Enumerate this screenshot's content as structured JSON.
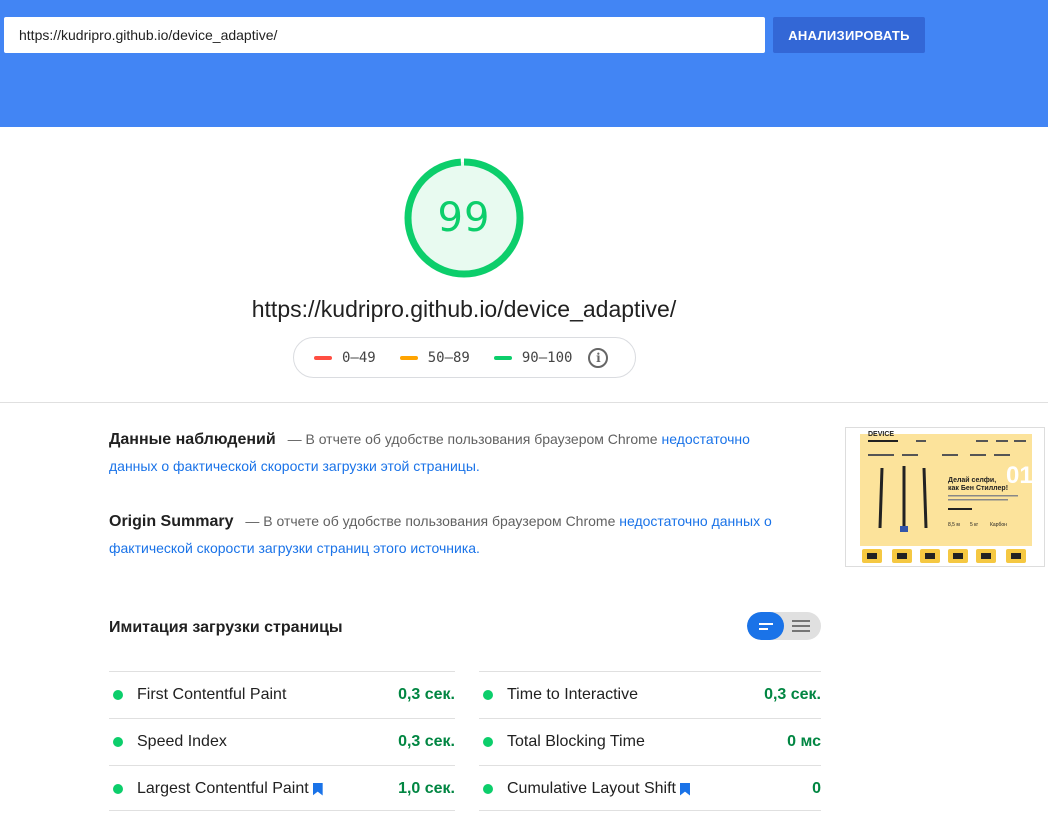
{
  "search": {
    "url_value": "https://kudripro.github.io/device_adaptive/",
    "analyze_label": "АНАЛИЗИРОВАТЬ"
  },
  "report": {
    "score": "99",
    "score_fraction": 0.99,
    "page_url": "https://kudripro.github.io/device_adaptive/"
  },
  "legend": {
    "items": [
      {
        "label": "0–49",
        "color": "#ff4e42"
      },
      {
        "label": "50–89",
        "color": "#ffa400"
      },
      {
        "label": "90–100",
        "color": "#0cce6b"
      }
    ],
    "info_icon": "info-icon"
  },
  "field_data": {
    "title": "Данные наблюдений",
    "dash": "—",
    "text": "В отчете об удобстве пользования браузером Chrome",
    "link": "недостаточно данных о фактической скорости загрузки этой страницы."
  },
  "origin_summary": {
    "title": "Origin Summary",
    "dash": "—",
    "text": "В отчете об удобстве пользования браузером Chrome",
    "link": "недостаточно данных о фактической скорости загрузки страниц этого источника."
  },
  "thumbnail": {
    "brand": "DEVICE",
    "headline_1": "Делай селфи,",
    "headline_2": "как Бен Стиллер!",
    "slide_number": "01",
    "stat_1": "8,5 м",
    "stat_2": "5 кг",
    "stat_3": "Карбон"
  },
  "lab": {
    "title": "Имитация загрузки страницы",
    "metrics": [
      {
        "name": "First Contentful Paint",
        "value": "0,3 сек.",
        "bookmark": false
      },
      {
        "name": "Time to Interactive",
        "value": "0,3 сек.",
        "bookmark": false
      },
      {
        "name": "Speed Index",
        "value": "0,3 сек.",
        "bookmark": false
      },
      {
        "name": "Total Blocking Time",
        "value": "0 мс",
        "bookmark": false
      },
      {
        "name": "Largest Contentful Paint",
        "value": "1,0 сек.",
        "bookmark": true
      },
      {
        "name": "Cumulative Layout Shift",
        "value": "0",
        "bookmark": true
      }
    ]
  },
  "colors": {
    "brand_blue": "#4285f4",
    "button_blue": "#3367d6",
    "pass_green": "#0cce6b",
    "value_green": "#018642",
    "link_blue": "#1a73e8"
  }
}
